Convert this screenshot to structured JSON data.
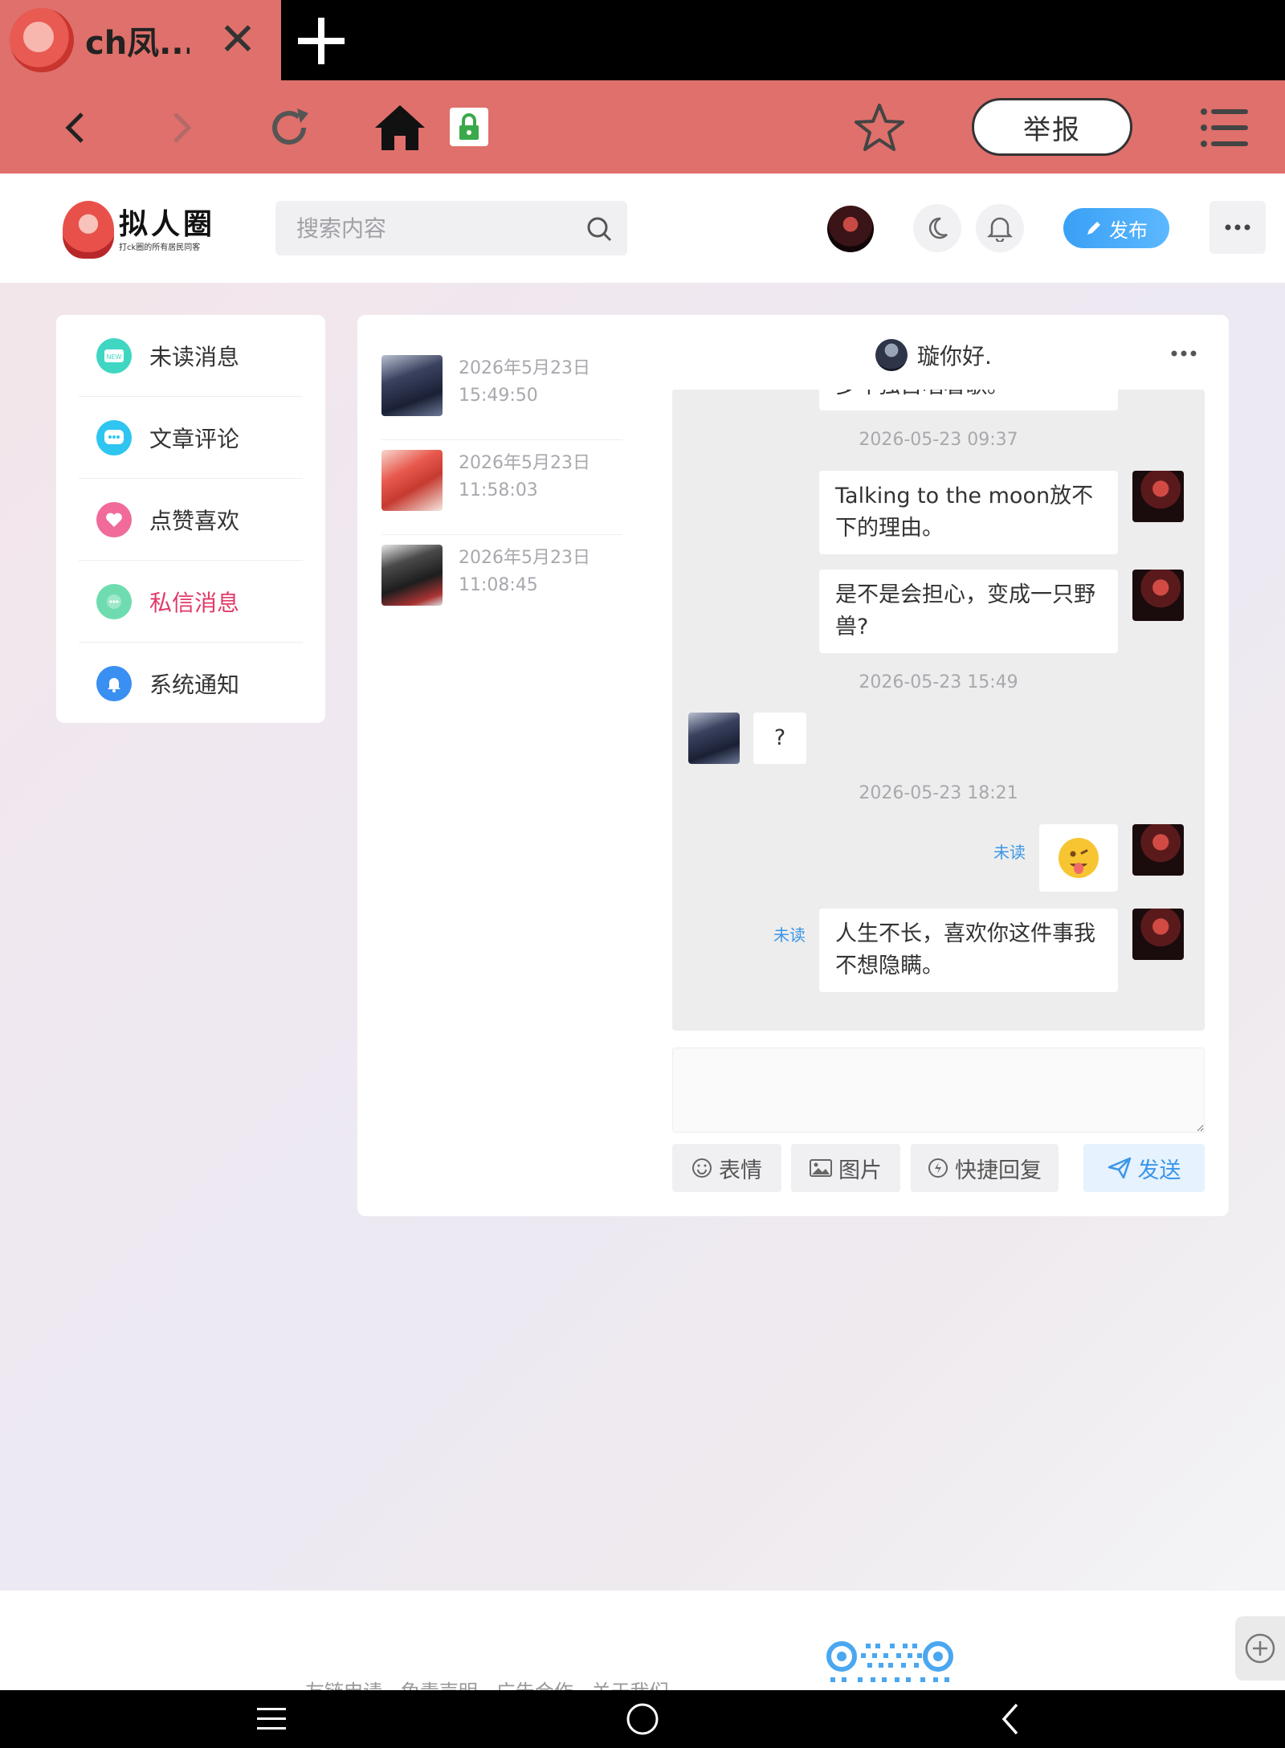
{
  "browser": {
    "tab_title": "ch凤...",
    "report_label": "举报"
  },
  "site": {
    "logo_title": "拟人圈",
    "logo_subtitle": "打ck圈的所有居民同客",
    "search_placeholder": "搜索内容",
    "publish_label": "发布"
  },
  "menu": {
    "items": [
      {
        "label": "未读消息",
        "icon": "new-badge-icon",
        "color": "#3fd6c2"
      },
      {
        "label": "文章评论",
        "icon": "comment-icon",
        "color": "#2ec5f0"
      },
      {
        "label": "点赞喜欢",
        "icon": "heart-icon",
        "color": "#f06a9a"
      },
      {
        "label": "私信消息",
        "icon": "chat-icon",
        "color": "#6fdcb0"
      },
      {
        "label": "系统通知",
        "icon": "bell-icon",
        "color": "#3a8ff2"
      }
    ],
    "active_index": 3,
    "active_color": "#e23a68"
  },
  "conversations": [
    {
      "date": "2026年5月23日",
      "time": "15:49:50"
    },
    {
      "date": "2026年5月23日",
      "time": "11:58:03"
    },
    {
      "date": "2026年5月23日",
      "time": "11:08:45"
    }
  ],
  "chat": {
    "peer_name": "璇你好.",
    "messages": {
      "m0_partial": "多年独自唱着歌。",
      "t1": "2026-05-23 09:37",
      "m1": "Talking to the moon放不下的理由。",
      "m2": "是不是会担心，变成一只野兽?",
      "t2": "2026-05-23 15:49",
      "m3": "?",
      "t3": "2026-05-23 18:21",
      "m4_emoji": "😛",
      "m5": "人生不长，喜欢你这件事我不想隐瞒。",
      "unread_label": "未读"
    },
    "actions": {
      "emoji": "表情",
      "image": "图片",
      "quick_reply": "快捷回复",
      "send": "发送"
    }
  },
  "footer": {
    "links": "友链申请 · 免责声明 · 广告合作 · 关于我们"
  }
}
